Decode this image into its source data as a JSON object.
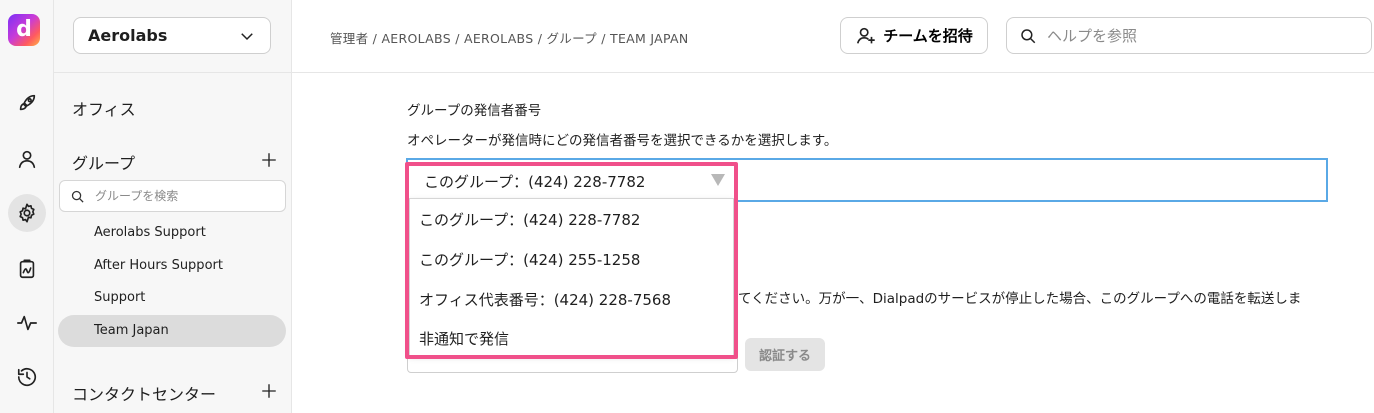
{
  "logo": {
    "letter": "d"
  },
  "rail": {
    "icons": [
      "rocket-icon",
      "user-icon",
      "gear-icon",
      "clipboard-icon",
      "activity-icon",
      "history-icon"
    ]
  },
  "sidebar": {
    "org_select": {
      "label": "Aerolabs"
    },
    "office_heading": "オフィス",
    "groups_heading": "グループ",
    "group_search": {
      "placeholder": "グループを検索"
    },
    "groups": [
      {
        "label": "Aerolabs Support"
      },
      {
        "label": "After Hours Support"
      },
      {
        "label": "Support"
      },
      {
        "label": "Team Japan"
      }
    ],
    "contact_center_heading": "コンタクトセンター"
  },
  "header": {
    "breadcrumb": "管理者 / AEROLABS / AEROLABS / グループ / TEAM JAPAN",
    "invite_label": "チームを招待",
    "help_search": {
      "placeholder": "ヘルプを参照"
    }
  },
  "main": {
    "section_title": "グループの発信者番号",
    "section_desc": "オペレーターが発信時にどの発信者番号を選択できるかを選択します。",
    "caller_id_select": {
      "selected": "このグループ：(424) 228-7782",
      "options": [
        "このグループ：(424) 228-7782",
        "このグループ：(424) 255-1258",
        "オフィス代表番号：(424) 228-7568",
        "非通知で発信"
      ]
    },
    "obscured_text_line1": "てください。万が一、Dialpadのサービスが停止した場合、このグループへの電話を転送しま",
    "verify_label": "認証する"
  },
  "colors": {
    "highlight": "#f0508a",
    "focus_border": "#5aa9e6"
  }
}
